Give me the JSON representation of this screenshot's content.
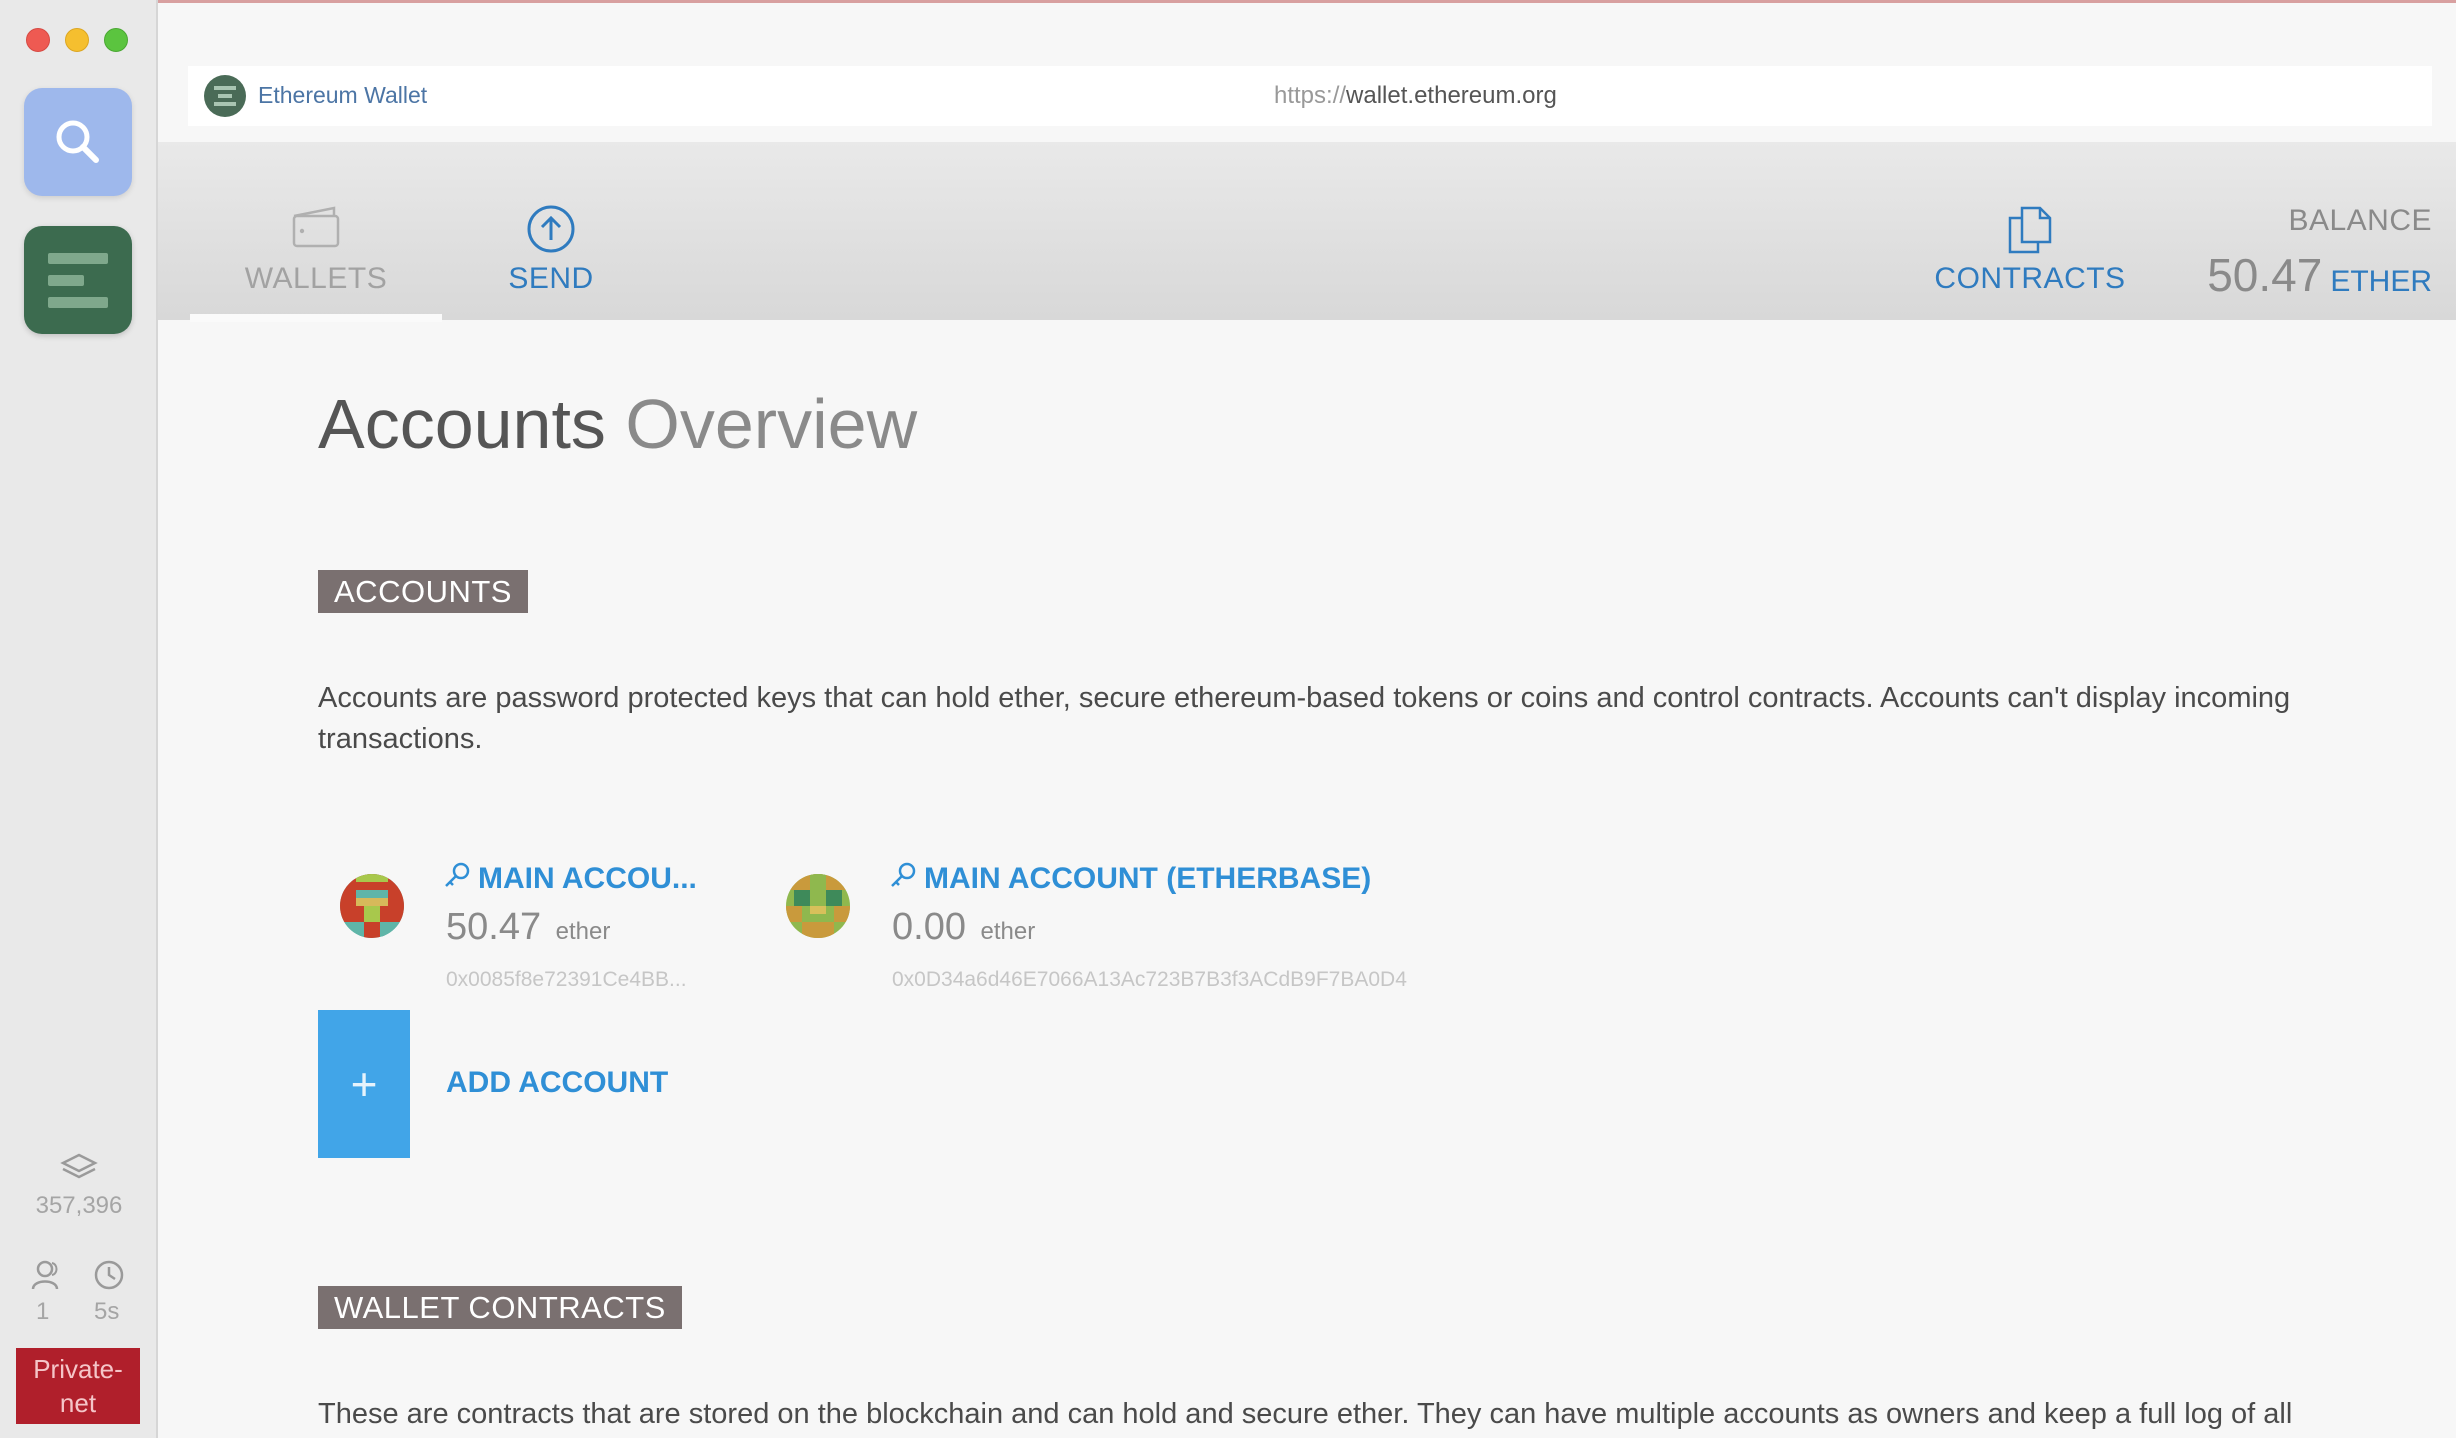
{
  "window": {
    "traffic_lights": [
      "close",
      "minimize",
      "zoom"
    ]
  },
  "sidebar": {
    "apps": [
      {
        "name": "search",
        "icon": "search-icon"
      },
      {
        "name": "ethereum-wallet",
        "icon": "ethereum-wallet-icon"
      }
    ],
    "blocks": "357,396",
    "peers": "1",
    "time": "5s",
    "network": "Private-net"
  },
  "urlbar": {
    "app_name": "Ethereum Wallet",
    "scheme": "https://",
    "host": "wallet.ethereum.org"
  },
  "nav": {
    "wallets": "WALLETS",
    "send": "SEND",
    "contracts": "CONTRACTS",
    "balance_label": "BALANCE",
    "balance_value": "50.47",
    "balance_unit": "ETHER"
  },
  "page": {
    "title_bold": "Accounts",
    "title_light": "Overview"
  },
  "accounts_section": {
    "heading": "ACCOUNTS",
    "description": "Accounts are password protected keys that can hold ether, secure ethereum-based tokens or coins and control contracts. Accounts can't display incoming transactions.",
    "accounts": [
      {
        "name": "MAIN ACCOU...",
        "balance": "50.47",
        "unit": "ether",
        "address": "0x0085f8e72391Ce4BB..."
      },
      {
        "name": "MAIN ACCOUNT (ETHERBASE)",
        "balance": "0.00",
        "unit": "ether",
        "address": "0x0D34a6d46E7066A13Ac723B7B3f3ACdB9F7BA0D4"
      }
    ],
    "add_button_symbol": "+",
    "add_label": "ADD ACCOUNT"
  },
  "contracts_section": {
    "heading": "WALLET CONTRACTS",
    "description": "These are contracts that are stored on the blockchain and can hold and secure ether. They can have multiple accounts as owners and keep a full log of all"
  },
  "colors": {
    "accent": "#2f8fd6",
    "nav_active": "#2f7bbf",
    "network_badge": "#b01f2b",
    "section_label_bg": "#7a7070",
    "add_button": "#41a5e8"
  }
}
